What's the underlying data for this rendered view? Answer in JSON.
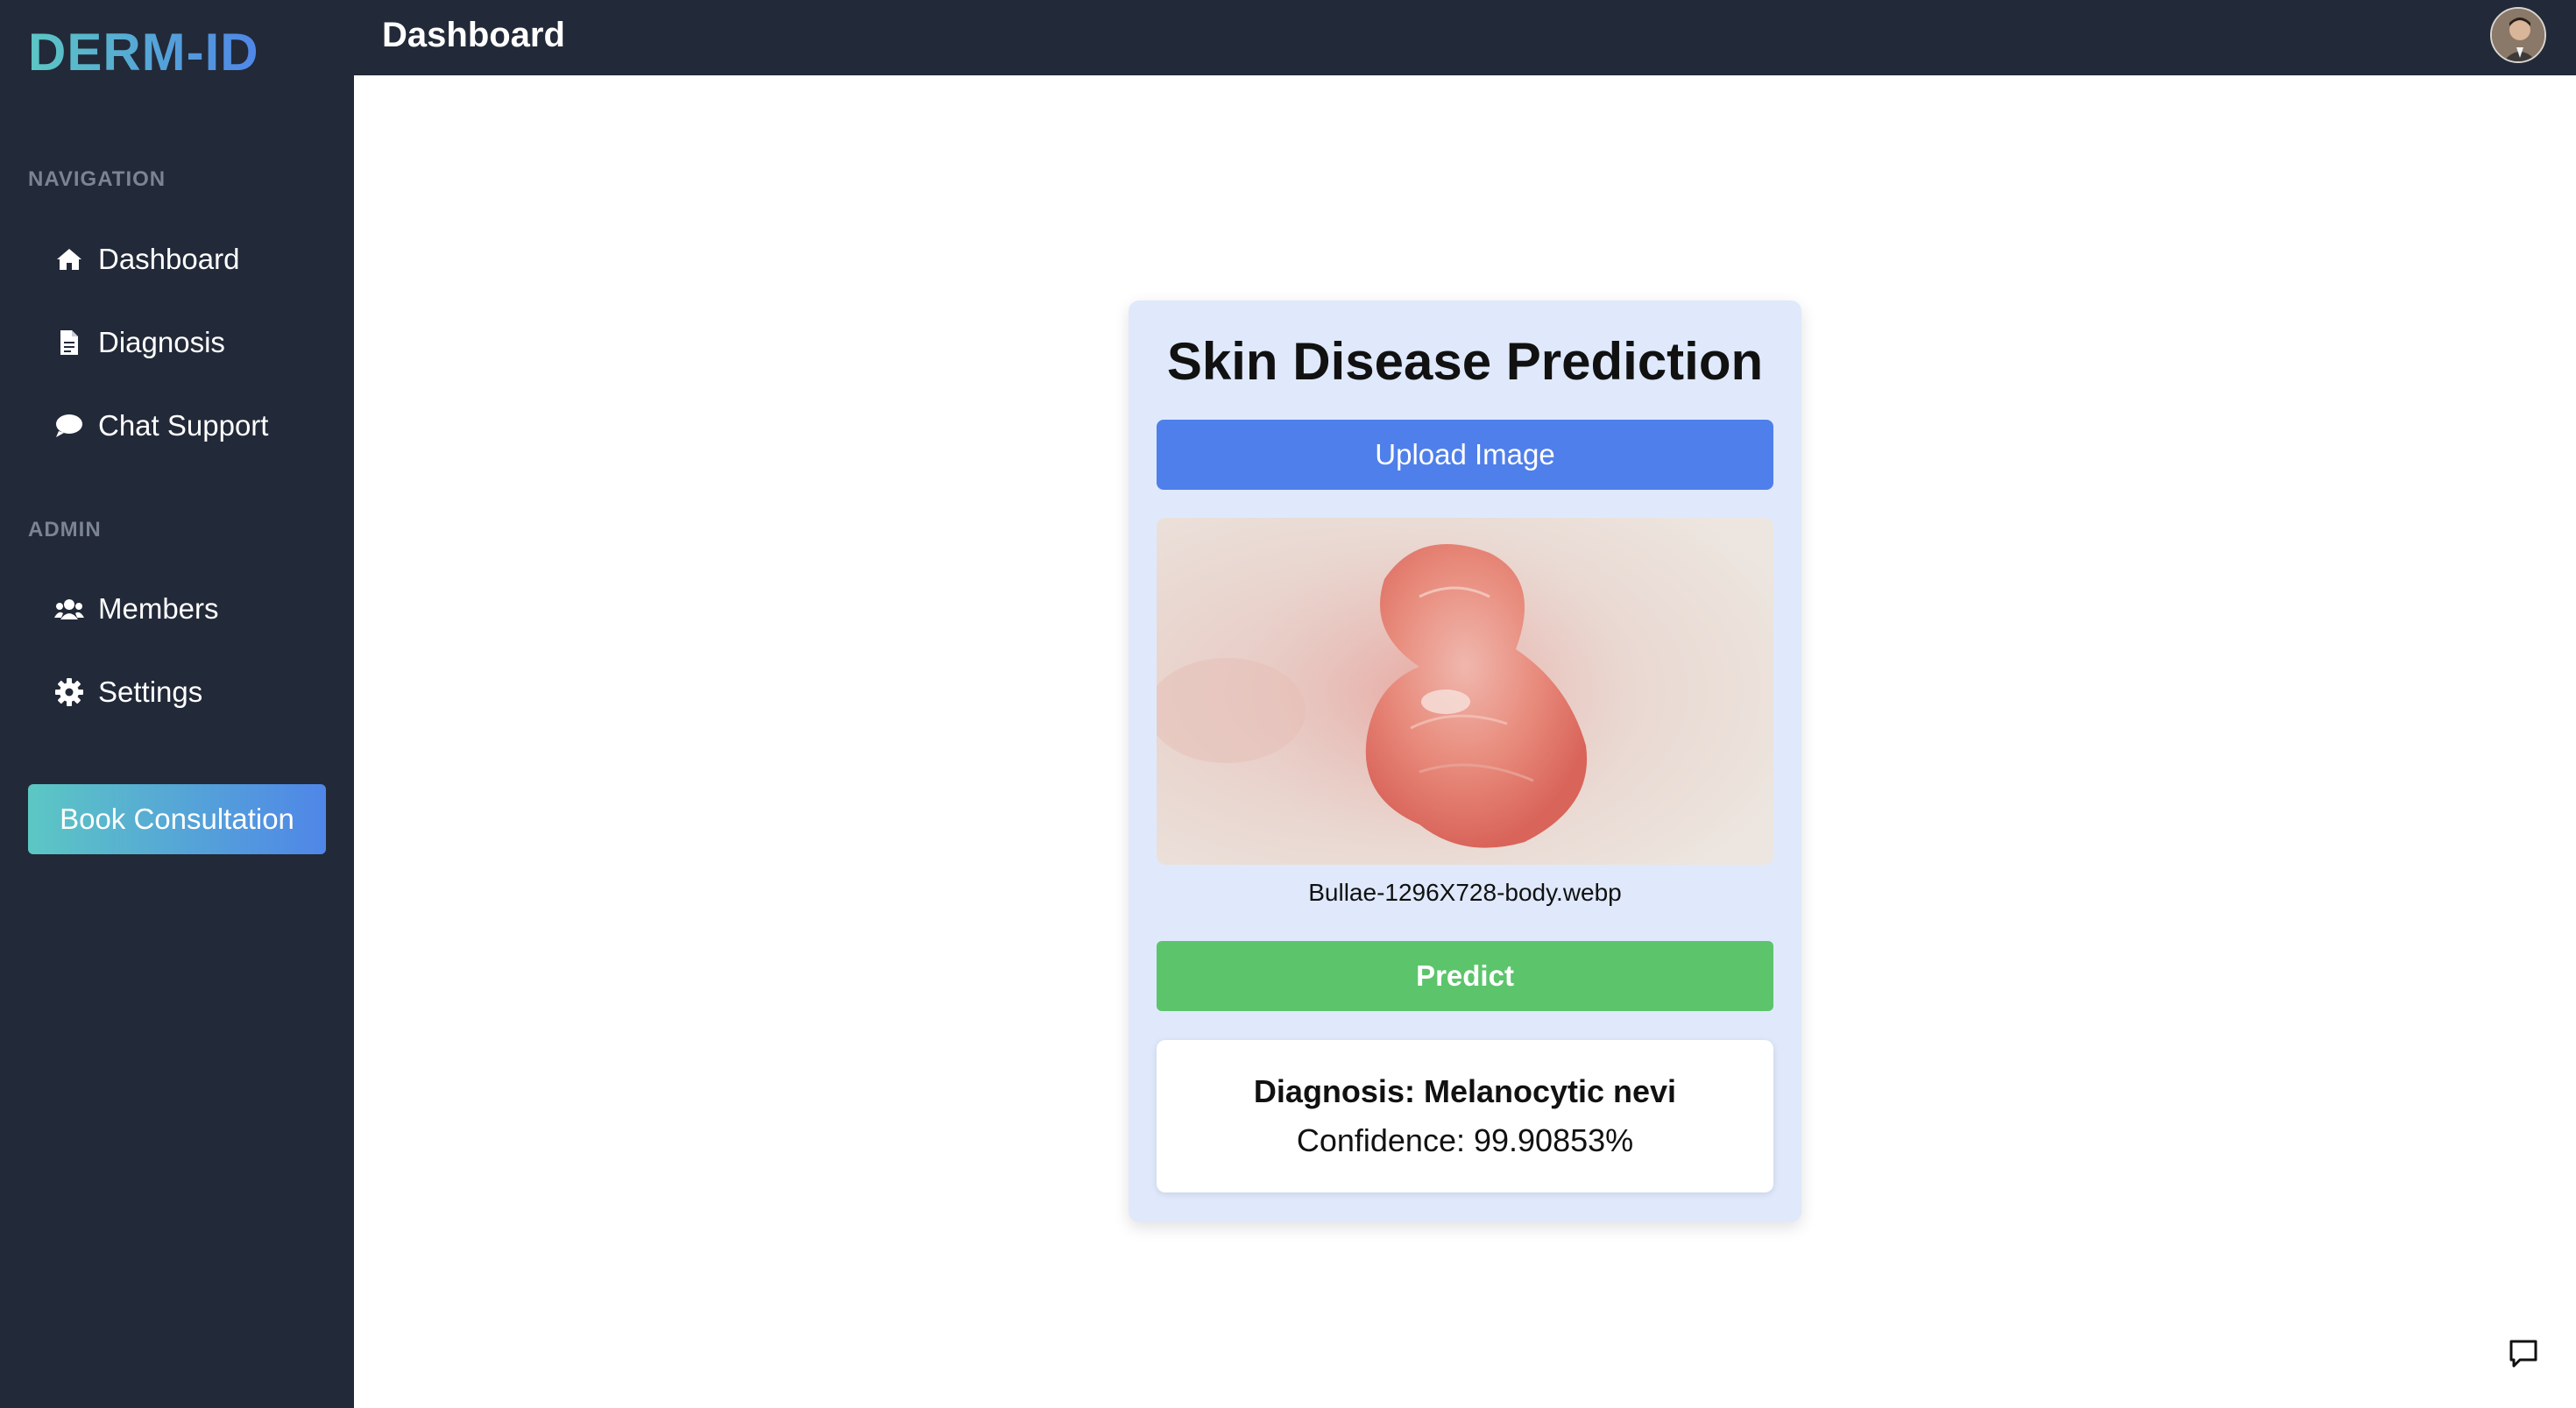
{
  "app": {
    "logo": "DERM-ID",
    "page_title": "Dashboard"
  },
  "sidebar": {
    "navigation_label": "NAVIGATION",
    "nav_items": [
      {
        "label": "Dashboard",
        "icon": "home-icon"
      },
      {
        "label": "Diagnosis",
        "icon": "document-icon"
      },
      {
        "label": "Chat Support",
        "icon": "chat-bubble-icon"
      }
    ],
    "admin_label": "ADMIN",
    "admin_items": [
      {
        "label": "Members",
        "icon": "users-icon"
      },
      {
        "label": "Settings",
        "icon": "gear-icon"
      }
    ],
    "cta_label": "Book Consultation"
  },
  "card": {
    "title": "Skin Disease Prediction",
    "upload_label": "Upload Image",
    "filename": "Bullae-1296X728-body.webp",
    "predict_label": "Predict",
    "result": {
      "diagnosis": "Diagnosis: Melanocytic nevi",
      "confidence": "Confidence: 99.90853%"
    }
  },
  "colors": {
    "sidebar_bg": "#222938",
    "accent_gradient_start": "#5cc7c4",
    "accent_gradient_end": "#4f86e8",
    "upload_button": "#4f7fea",
    "predict_button": "#5cc46b",
    "card_bg": "#dfe9fb"
  }
}
